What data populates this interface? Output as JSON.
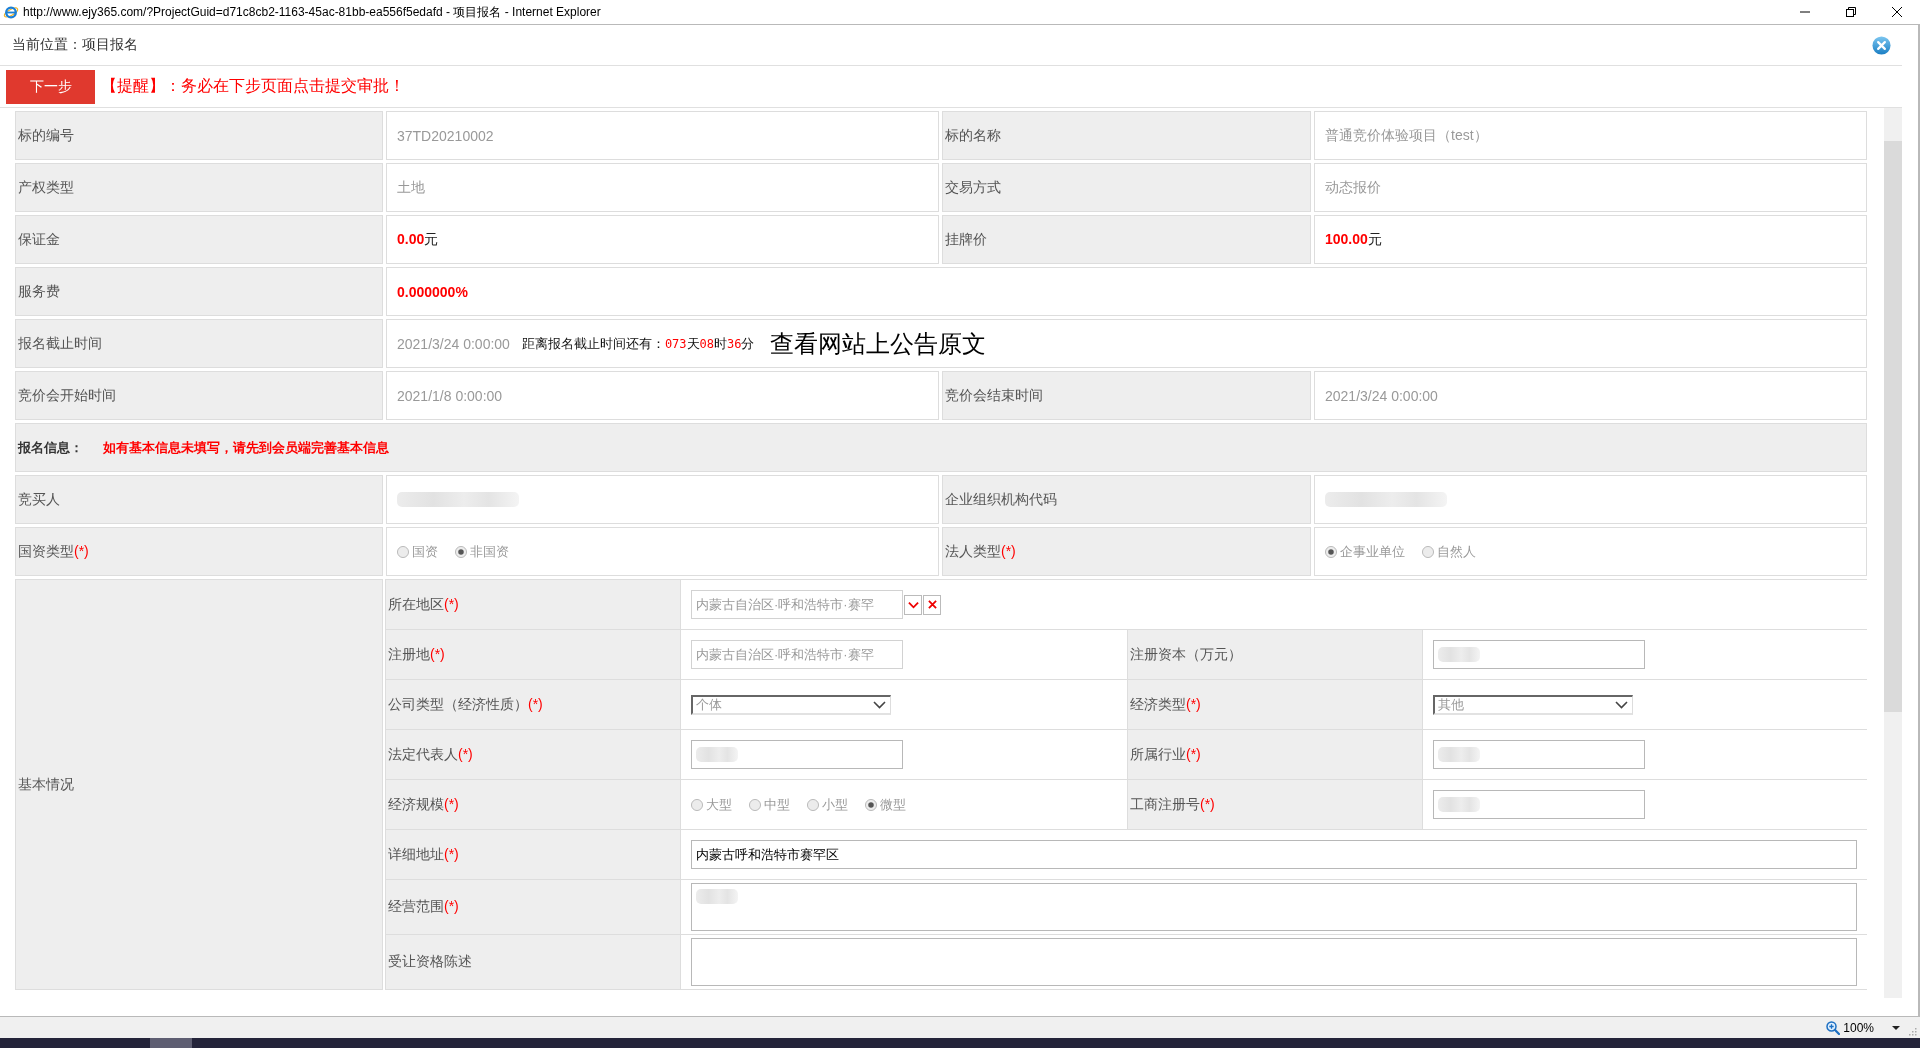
{
  "window": {
    "title": "http://www.ejy365.com/?ProjectGuid=d71c8cb2-1163-45ac-81bb-ea556f5edafd - 项目报名 - Internet Explorer"
  },
  "breadcrumb": "当前位置：项目报名",
  "toolbar": {
    "next_button": "下一步",
    "reminder": "【提醒】：务必在下步页面点击提交审批！"
  },
  "project_rows": [
    {
      "cells": [
        {
          "label": "标的编号",
          "kind": "text",
          "value": "37TD20210002"
        },
        {
          "label": "标的名称",
          "kind": "text",
          "value": "普通竞价体验项目（test）"
        }
      ]
    },
    {
      "cells": [
        {
          "label": "产权类型",
          "kind": "text",
          "value": "土地"
        },
        {
          "label": "交易方式",
          "kind": "text",
          "value": "动态报价"
        }
      ]
    },
    {
      "cells": [
        {
          "label": "保证金",
          "kind": "money",
          "amount": "0.00",
          "unit": "元"
        },
        {
          "label": "挂牌价",
          "kind": "money",
          "amount": "100.00",
          "unit": "元"
        }
      ]
    },
    {
      "cells": [
        {
          "label": "服务费",
          "kind": "rate",
          "value": "0.000000%"
        }
      ]
    },
    {
      "cells": [
        {
          "label": "报名截止时间",
          "kind": "deadline",
          "value": "2021/3/24 0:00:00",
          "countdown": {
            "label": "距离报名截止时间还有：",
            "parts": [
              {
                "number": "073",
                "unit": "天"
              },
              {
                "number": "08",
                "unit": "时"
              },
              {
                "number": "36",
                "unit": "分"
              }
            ]
          },
          "link": "查看网站上公告原文"
        }
      ]
    },
    {
      "cells": [
        {
          "label": "竞价会开始时间",
          "kind": "text",
          "value": "2021/1/8 0:00:00"
        },
        {
          "label": "竞价会结束时间",
          "kind": "text",
          "value": "2021/3/24 0:00:00"
        }
      ]
    }
  ],
  "registration": {
    "title": "报名信息：",
    "notice": "如有基本信息未填写，请先到会员端完善基本信息",
    "rows": [
      {
        "cells": [
          {
            "label": "竞买人",
            "kind": "redacted"
          },
          {
            "label": "企业组织机构代码",
            "kind": "redacted"
          }
        ]
      },
      {
        "cells": [
          {
            "label": "国资类型",
            "required_mark": "(*)",
            "kind": "radio",
            "options": [
              {
                "label": "国资",
                "selected": false
              },
              {
                "label": "非国资",
                "selected": true
              }
            ]
          },
          {
            "label": "法人类型",
            "required_mark": "(*)",
            "kind": "radio",
            "options": [
              {
                "label": "企事业单位",
                "selected": true
              },
              {
                "label": "自然人",
                "selected": false
              }
            ]
          }
        ]
      }
    ]
  },
  "basic_info": {
    "title": "基本情况",
    "rows": [
      {
        "cells": [
          {
            "label": "所在地区",
            "required_mark": "(*)",
            "kind": "region",
            "value": "内蒙古自治区·呼和浩特市·赛罕",
            "disabled": true
          }
        ]
      },
      {
        "cells": [
          {
            "label": "注册地",
            "required_mark": "(*)",
            "kind": "input",
            "value": "内蒙古自治区·呼和浩特市·赛罕",
            "disabled": true,
            "redacted": false
          },
          {
            "label": "注册资本（万元）",
            "kind": "input",
            "disabled": false,
            "redacted": true
          }
        ]
      },
      {
        "cells": [
          {
            "label": "公司类型（经济性质）",
            "required_mark": "(*)",
            "kind": "select",
            "value": "个体",
            "disabled": true
          },
          {
            "label": "经济类型",
            "required_mark": "(*)",
            "kind": "select",
            "value": "其他",
            "disabled": true
          }
        ]
      },
      {
        "cells": [
          {
            "label": "法定代表人",
            "required_mark": "(*)",
            "kind": "input",
            "disabled": false,
            "redacted": true
          },
          {
            "label": "所属行业",
            "required_mark": "(*)",
            "kind": "input",
            "disabled": false,
            "redacted": true
          }
        ]
      },
      {
        "cells": [
          {
            "label": "经济规模",
            "required_mark": "(*)",
            "kind": "radio",
            "options": [
              {
                "label": "大型",
                "selected": false
              },
              {
                "label": "中型",
                "selected": false
              },
              {
                "label": "小型",
                "selected": false
              },
              {
                "label": "微型",
                "selected": true
              }
            ]
          },
          {
            "label": "工商注册号",
            "required_mark": "(*)",
            "kind": "input",
            "disabled": false,
            "redacted": true
          }
        ]
      },
      {
        "cells": [
          {
            "label": "详细地址",
            "required_mark": "(*)",
            "kind": "input",
            "value": "内蒙古呼和浩特市赛罕区",
            "disabled": false,
            "redacted": false
          }
        ]
      },
      {
        "cells": [
          {
            "label": "经营范围",
            "required_mark": "(*)",
            "kind": "textarea",
            "disabled": false,
            "redacted": true
          }
        ]
      },
      {
        "cells": [
          {
            "label": "受让资格陈述",
            "kind": "textarea",
            "disabled": false,
            "redacted": false
          }
        ]
      }
    ]
  },
  "status_bar": {
    "zoom": "100%"
  }
}
